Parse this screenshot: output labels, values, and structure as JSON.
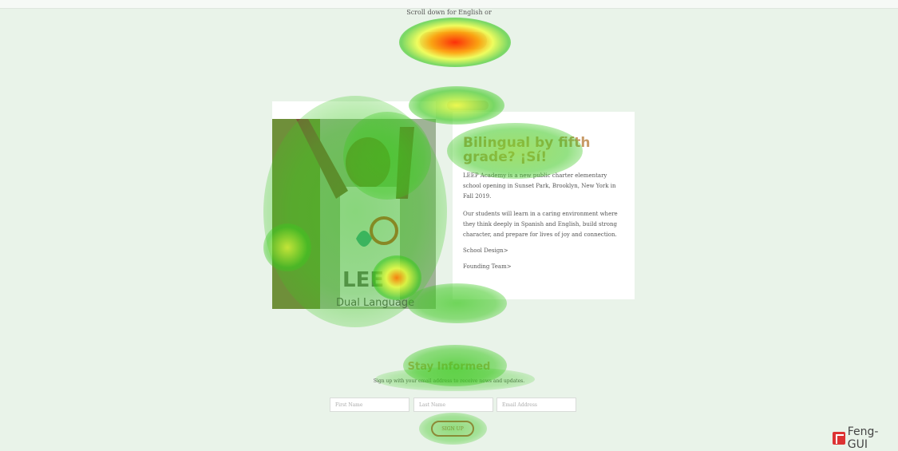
{
  "top": {
    "scroll_text": "Scroll down for English or"
  },
  "hero": {
    "title": "Bilingual by fifth grade? ¡Sí!",
    "paragraph1": "LEEP Academy is a new public charter elementary school opening in Sunset Park, Brooklyn, New York in Fall 2019.",
    "paragraph2": "Our students will learn in a caring environment where they think deeply in Spanish and English, build strong character, and prepare for lives of joy and connection.",
    "link_school_design": "School Design>",
    "link_founding_team": "Founding Team>",
    "photo_caption": "Dual Language"
  },
  "signup": {
    "title": "Stay Informed",
    "subtitle": "Sign up with your email address to receive news and updates.",
    "first_name_placeholder": "First Name",
    "last_name_placeholder": "Last Name",
    "email_placeholder": "Email Address",
    "button_label": "SIGN UP"
  },
  "badge": {
    "label": "Feng-GUI"
  },
  "colors": {
    "heat_red": "#ff2a00",
    "heat_yellow": "#f4ff3a",
    "heat_green": "#39c51a",
    "accent_button": "#c85a4a"
  }
}
